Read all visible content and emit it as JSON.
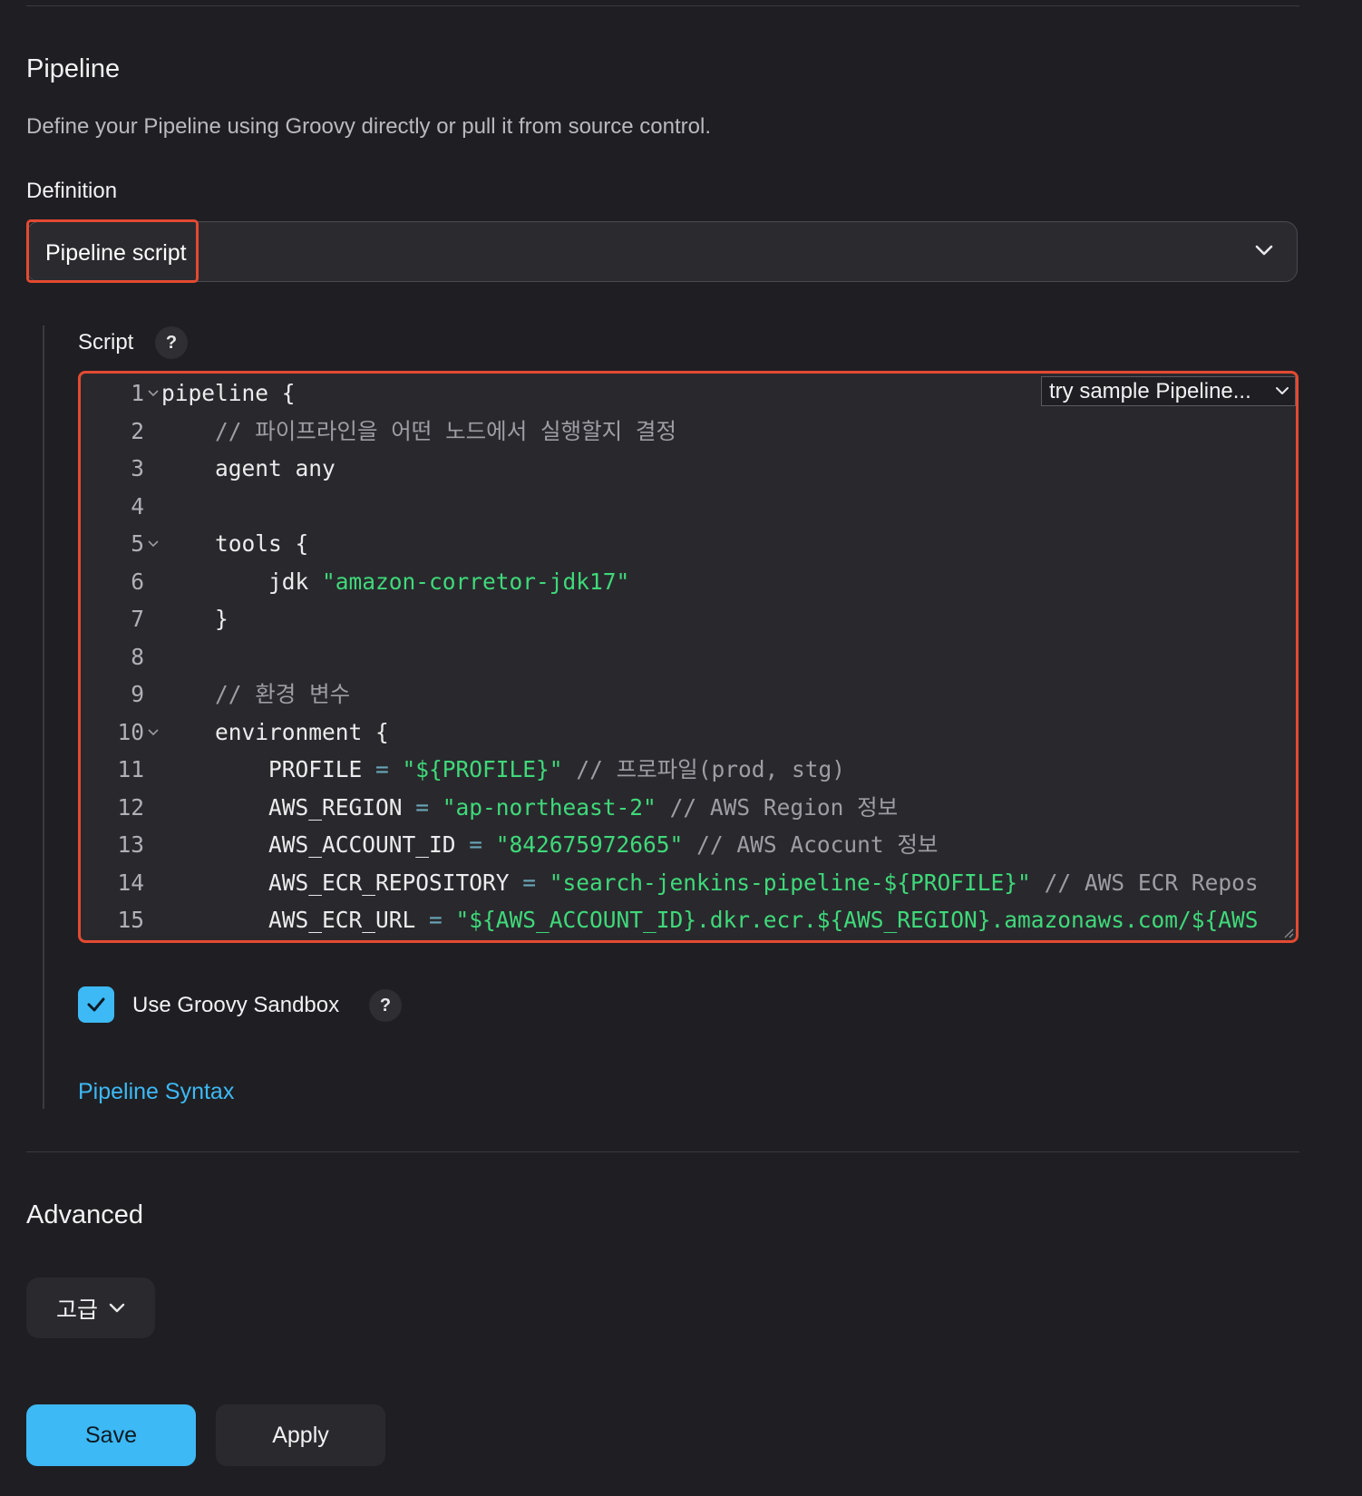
{
  "pipeline": {
    "title": "Pipeline",
    "description": "Define your Pipeline using Groovy directly or pull it from source control.",
    "definition_label": "Definition",
    "definition_value": "Pipeline script"
  },
  "script": {
    "label": "Script",
    "help": "?",
    "sample_button": "try sample Pipeline...",
    "lines": [
      {
        "num": "1",
        "fold": true,
        "indent": "",
        "tokens": [
          {
            "t": "plain",
            "v": "pipeline {"
          }
        ]
      },
      {
        "num": "2",
        "fold": false,
        "indent": "    ",
        "tokens": [
          {
            "t": "com",
            "v": "// 파이프라인을 어떤 노드에서 실행할지 결정"
          }
        ]
      },
      {
        "num": "3",
        "fold": false,
        "indent": "    ",
        "tokens": [
          {
            "t": "plain",
            "v": "agent any"
          }
        ]
      },
      {
        "num": "4",
        "fold": false,
        "indent": "",
        "tokens": []
      },
      {
        "num": "5",
        "fold": true,
        "indent": "    ",
        "tokens": [
          {
            "t": "plain",
            "v": "tools {"
          }
        ]
      },
      {
        "num": "6",
        "fold": false,
        "indent": "        ",
        "tokens": [
          {
            "t": "plain",
            "v": "jdk "
          },
          {
            "t": "str",
            "v": "\"amazon-corretor-jdk17\""
          }
        ]
      },
      {
        "num": "7",
        "fold": false,
        "indent": "    ",
        "tokens": [
          {
            "t": "plain",
            "v": "}"
          }
        ]
      },
      {
        "num": "8",
        "fold": false,
        "indent": "",
        "tokens": []
      },
      {
        "num": "9",
        "fold": false,
        "indent": "    ",
        "tokens": [
          {
            "t": "com",
            "v": "// 환경 변수"
          }
        ]
      },
      {
        "num": "10",
        "fold": true,
        "indent": "    ",
        "tokens": [
          {
            "t": "plain",
            "v": "environment {"
          }
        ]
      },
      {
        "num": "11",
        "fold": false,
        "indent": "        ",
        "tokens": [
          {
            "t": "plain",
            "v": "PROFILE "
          },
          {
            "t": "op",
            "v": "= "
          },
          {
            "t": "str",
            "v": "\"${PROFILE}\""
          },
          {
            "t": "com",
            "v": " // 프로파일(prod, stg)"
          }
        ]
      },
      {
        "num": "12",
        "fold": false,
        "indent": "        ",
        "tokens": [
          {
            "t": "plain",
            "v": "AWS_REGION "
          },
          {
            "t": "op",
            "v": "= "
          },
          {
            "t": "str",
            "v": "\"ap-northeast-2\""
          },
          {
            "t": "com",
            "v": " // AWS Region 정보"
          }
        ]
      },
      {
        "num": "13",
        "fold": false,
        "indent": "        ",
        "tokens": [
          {
            "t": "plain",
            "v": "AWS_ACCOUNT_ID "
          },
          {
            "t": "op",
            "v": "= "
          },
          {
            "t": "str",
            "v": "\"842675972665\""
          },
          {
            "t": "com",
            "v": " // AWS Acocunt 정보"
          }
        ]
      },
      {
        "num": "14",
        "fold": false,
        "indent": "        ",
        "tokens": [
          {
            "t": "plain",
            "v": "AWS_ECR_REPOSITORY "
          },
          {
            "t": "op",
            "v": "= "
          },
          {
            "t": "str",
            "v": "\"search-jenkins-pipeline-${PROFILE}\""
          },
          {
            "t": "com",
            "v": " // AWS ECR Repos"
          }
        ]
      },
      {
        "num": "15",
        "fold": false,
        "indent": "        ",
        "tokens": [
          {
            "t": "plain",
            "v": "AWS_ECR_URL "
          },
          {
            "t": "op",
            "v": "= "
          },
          {
            "t": "str",
            "v": "\"${AWS_ACCOUNT_ID}.dkr.ecr.${AWS_REGION}.amazonaws.com/${AWS"
          }
        ]
      }
    ]
  },
  "sandbox": {
    "label": "Use Groovy Sandbox",
    "checked": true,
    "help": "?"
  },
  "syntax_link": "Pipeline Syntax",
  "advanced": {
    "title": "Advanced",
    "button": "고급"
  },
  "actions": {
    "save": "Save",
    "apply": "Apply"
  },
  "colors": {
    "accent": "#3db9f5",
    "highlight_border": "#e34a32",
    "string": "#3fd97a",
    "background": "#1f1f23"
  }
}
